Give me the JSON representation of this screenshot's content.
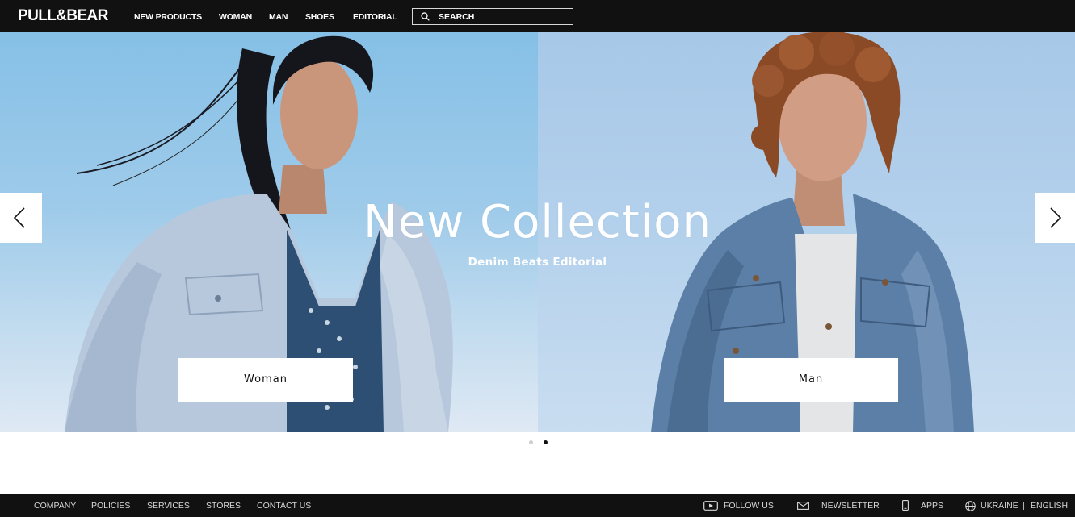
{
  "header": {
    "logo": "PULL&BEAR",
    "nav": [
      {
        "label": "NEW PRODUCTS"
      },
      {
        "label": "WOMAN"
      },
      {
        "label": "MAN"
      },
      {
        "label": "SHOES"
      },
      {
        "label": "EDITORIAL"
      }
    ],
    "search": {
      "placeholder": "SEARCH",
      "icon": "search-icon"
    }
  },
  "hero": {
    "title": "New Collection",
    "subtitle": "Denim Beats Editorial",
    "cta_woman": "Woman",
    "cta_man": "Man",
    "prev_icon": "chevron-left-icon",
    "next_icon": "chevron-right-icon",
    "slides": {
      "count": 2,
      "active": 2
    }
  },
  "footer": {
    "links": [
      "COMPANY",
      "POLICIES",
      "SERVICES",
      "STORES",
      "CONTACT US"
    ],
    "follow_us": "FOLLOW US",
    "newsletter": "NEWSLETTER",
    "apps": "APPS",
    "country": "UKRAINE",
    "separator": "|",
    "language": "ENGLISH"
  },
  "colors": {
    "bar": "#111111",
    "text_on_dark": "#ffffff",
    "footer_text": "#d8d8d8",
    "dot_active": "#111111",
    "dot_inactive": "#cfcfcf"
  }
}
